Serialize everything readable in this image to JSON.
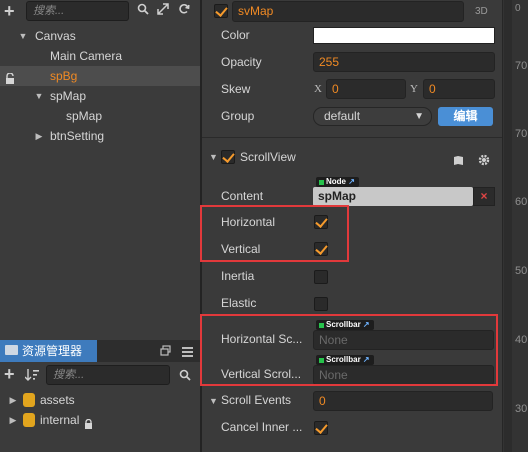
{
  "hierarchy": {
    "search_placeholder": "搜索...",
    "items": [
      {
        "label": "Canvas",
        "arrow": "▼"
      },
      {
        "label": "Main Camera"
      },
      {
        "label": "spBg"
      },
      {
        "label": "spMap",
        "arrow": "▼"
      },
      {
        "label": "spMap"
      },
      {
        "label": "btnSetting",
        "arrow": "▶"
      }
    ]
  },
  "assets": {
    "tab_label": "资源管理器",
    "search_placeholder": "搜索...",
    "items": [
      {
        "label": "assets"
      },
      {
        "label": "internal"
      }
    ]
  },
  "inspector": {
    "node_name": "svMap",
    "mode_3d": "3D",
    "color_label": "Color",
    "color_value": "#ffffff",
    "opacity_label": "Opacity",
    "opacity_value": "255",
    "skew_label": "Skew",
    "skew_x_label": "X",
    "skew_x_value": "0",
    "skew_y_label": "Y",
    "skew_y_value": "0",
    "group_label": "Group",
    "group_value": "default",
    "edit_button": "编辑",
    "scrollview": {
      "title": "ScrollView",
      "content_label": "Content",
      "content_badge": "Node",
      "content_value": "spMap",
      "horizontal_label": "Horizontal",
      "horizontal_checked": true,
      "vertical_label": "Vertical",
      "vertical_checked": true,
      "inertia_label": "Inertia",
      "inertia_checked": false,
      "elastic_label": "Elastic",
      "elastic_checked": false,
      "hscroll_label": "Horizontal Sc...",
      "hscroll_badge": "Scrollbar",
      "hscroll_value": "None",
      "vscroll_label": "Vertical Scrol...",
      "vscroll_badge": "Scrollbar",
      "vscroll_value": "None"
    },
    "scroll_events_label": "Scroll Events",
    "scroll_events_value": "0",
    "cancel_inner_label": "Cancel Inner ...",
    "cancel_inner_checked": true
  },
  "scene_ruler": [
    "70",
    "60",
    "50",
    "40",
    "30"
  ],
  "colors": {
    "selected_orange": "#f08a24",
    "checkbox_orange": "#f59a2c",
    "highlight_red": "#e2393b",
    "tab_blue": "#3e7bbd",
    "edit_blue": "#4a8fd6"
  }
}
